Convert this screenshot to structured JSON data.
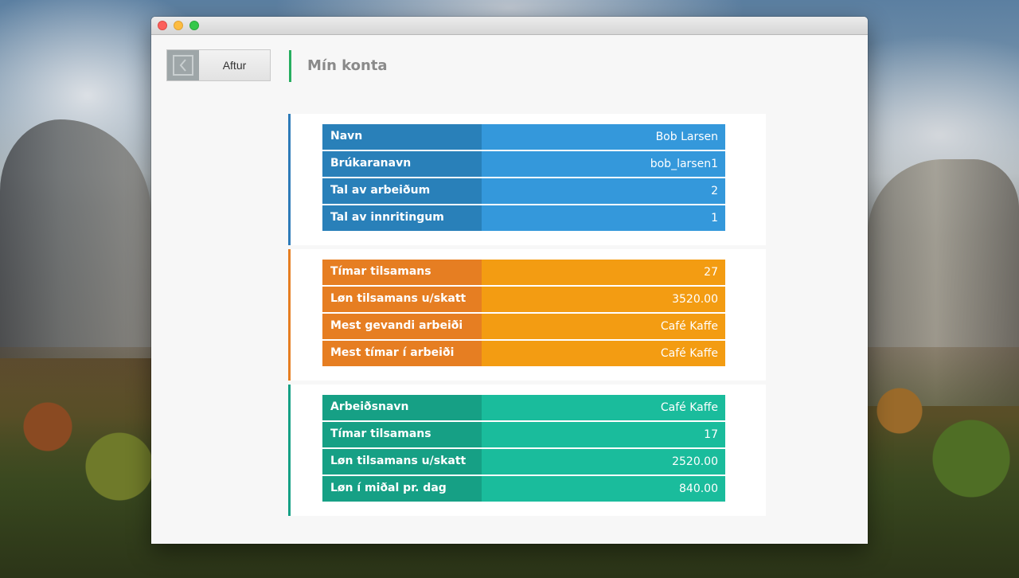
{
  "back_button": {
    "icon": "chevron-left-icon",
    "label": "Aftur"
  },
  "page_title": "Mín konta",
  "colors": {
    "title_accent": "#27ae60",
    "blue_label": "#2980b9",
    "blue_value": "#3498db",
    "orange_label": "#e67e22",
    "orange_value": "#f39c12",
    "green_label": "#16a085",
    "green_value": "#1abc9c"
  },
  "sections": [
    {
      "rows": [
        {
          "label": "Navn",
          "value": "Bob  Larsen"
        },
        {
          "label": "Brúkaranavn",
          "value": "bob_larsen1"
        },
        {
          "label": "Tal av arbeiðum",
          "value": "2"
        },
        {
          "label": "Tal av innritingum",
          "value": "1"
        }
      ]
    },
    {
      "rows": [
        {
          "label": "Tímar tilsamans",
          "value": "27"
        },
        {
          "label": "Løn tilsamans u/skatt",
          "value": "3520.00"
        },
        {
          "label": "Mest gevandi arbeiði",
          "value": "Café Kaffe"
        },
        {
          "label": "Mest tímar í arbeiði",
          "value": "Café Kaffe"
        }
      ]
    },
    {
      "rows": [
        {
          "label": "Arbeiðsnavn",
          "value": "Café Kaffe"
        },
        {
          "label": "Tímar tilsamans",
          "value": "17"
        },
        {
          "label": "Løn tilsamans u/skatt",
          "value": "2520.00"
        },
        {
          "label": "Løn í miðal pr. dag",
          "value": "840.00"
        }
      ]
    }
  ]
}
